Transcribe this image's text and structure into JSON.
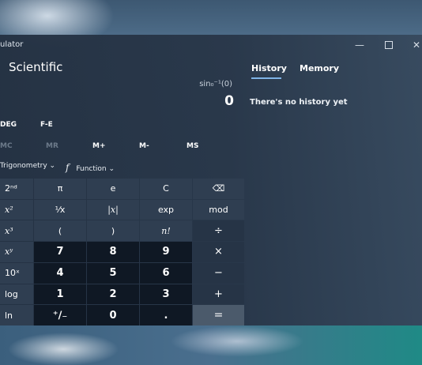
{
  "window": {
    "title": "ulator",
    "controls": {
      "minimize": "—",
      "maximize": "",
      "close": "✕"
    }
  },
  "mode": {
    "title": "Scientific"
  },
  "display": {
    "expression": "sin₀⁻¹(0)",
    "value": "0"
  },
  "toggles": {
    "angle": "DEG",
    "fe": "F-E"
  },
  "memory": {
    "mc": "MC",
    "mr": "MR",
    "mplus": "M+",
    "mminus": "M-",
    "ms": "MS"
  },
  "functions": {
    "trigonometry": "Trigonometry",
    "trig_chevron": "⌄",
    "function_icon": "f",
    "function_label": "Function",
    "function_chevron": "⌄"
  },
  "keys": [
    [
      "2ⁿᵈ",
      "π",
      "e",
      "C",
      "⌫"
    ],
    [
      "x²",
      "¹⁄x",
      "|x|",
      "exp",
      "mod"
    ],
    [
      "x³",
      "(",
      ")",
      "n!",
      "÷"
    ],
    [
      "xʸ",
      "7",
      "8",
      "9",
      "×"
    ],
    [
      "10ˣ",
      "4",
      "5",
      "6",
      "−"
    ],
    [
      "log",
      "1",
      "2",
      "3",
      "+"
    ],
    [
      "ln",
      "⁺∕₋",
      "0",
      ".",
      "="
    ]
  ],
  "panel": {
    "tab_history": "History",
    "tab_memory": "Memory",
    "empty_message": "There's no history yet"
  }
}
